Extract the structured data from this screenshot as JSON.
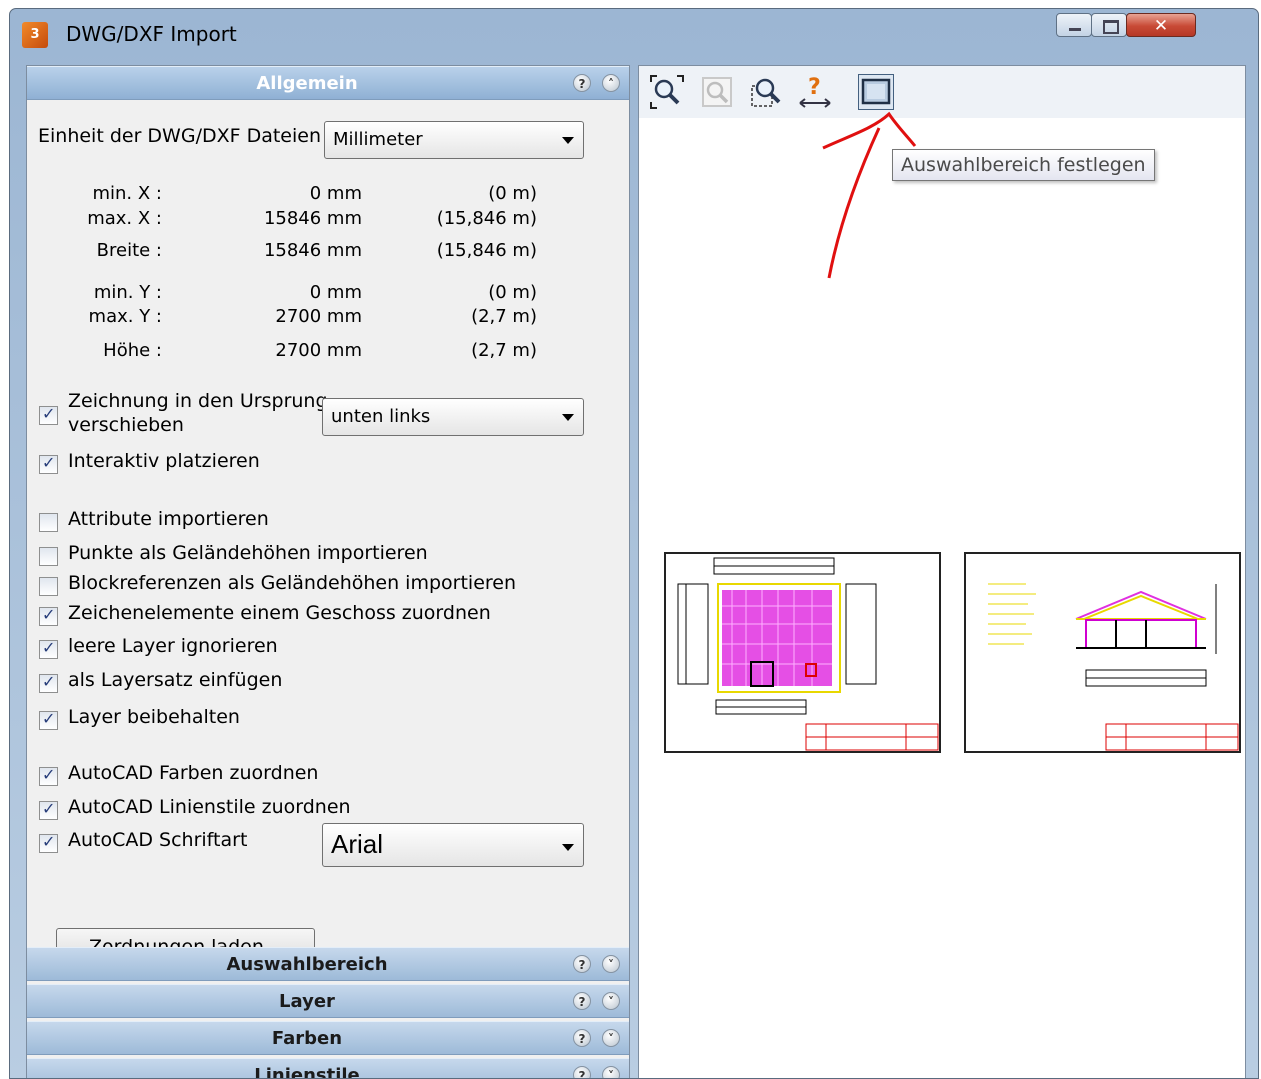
{
  "window": {
    "title": "DWG/DXF Import"
  },
  "sections": {
    "allgemein": "Allgemein",
    "auswahlbereich": "Auswahlbereich",
    "layer": "Layer",
    "farben": "Farben",
    "linienstile": "Linienstile"
  },
  "unit": {
    "label": "Einheit der DWG/DXF Dateien :",
    "value": "Millimeter"
  },
  "dims": [
    {
      "label": "min. X :",
      "mm": "0 mm",
      "m": "(0 m)"
    },
    {
      "label": "max. X :",
      "mm": "15846 mm",
      "m": "(15,846 m)"
    },
    {
      "label": "Breite :",
      "mm": "15846 mm",
      "m": "(15,846 m)"
    },
    {
      "label": "min. Y :",
      "mm": "0 mm",
      "m": "(0 m)"
    },
    {
      "label": "max. Y :",
      "mm": "2700 mm",
      "m": "(2,7 m)"
    },
    {
      "label": "Höhe :",
      "mm": "2700 mm",
      "m": "(2,7 m)"
    }
  ],
  "origin": {
    "label_line1": "Zeichnung in den Ursprung",
    "label_line2": "verschieben",
    "checked": true,
    "value": "unten links"
  },
  "options": [
    {
      "label": "Interaktiv platzieren",
      "checked": true
    },
    {
      "label": "Attribute importieren",
      "checked": false
    },
    {
      "label": "Punkte als Geländehöhen importieren",
      "checked": false
    },
    {
      "label": "Blockreferenzen als Geländehöhen importieren",
      "checked": false
    },
    {
      "label": "Zeichenelemente einem Geschoss zuordnen",
      "checked": true
    },
    {
      "label": "leere Layer ignorieren",
      "checked": true
    },
    {
      "label": "als Layersatz einfügen",
      "checked": true
    },
    {
      "label": "Layer beibehalten",
      "checked": true
    },
    {
      "label": "AutoCAD Farben zuordnen",
      "checked": true
    },
    {
      "label": "AutoCAD Linienstile zuordnen",
      "checked": true
    },
    {
      "label": "AutoCAD Schriftart",
      "checked": true
    }
  ],
  "font": {
    "value": "Arial"
  },
  "load_button": "Zordnungen laden...",
  "toolbar": {
    "icons": [
      "zoom-all-icon",
      "zoom-disabled-icon",
      "zoom-window-icon",
      "measure-icon",
      "selection-area-icon"
    ]
  },
  "tooltip": "Auswahlbereich festlegen",
  "colors": {
    "accent": "#8fb0d4",
    "annotation": "#e01010",
    "plan_fill": "#e030e0"
  }
}
